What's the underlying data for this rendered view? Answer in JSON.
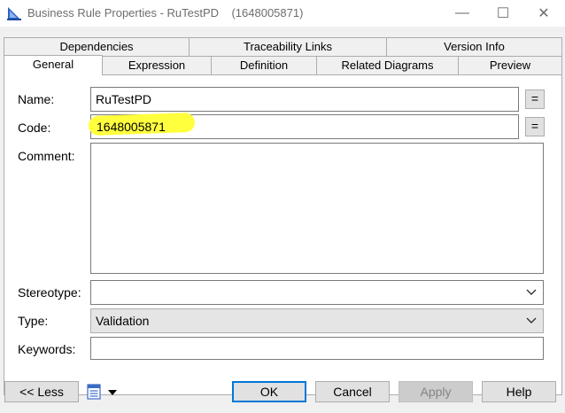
{
  "window": {
    "title": "Business Rule Properties - RuTestPD    (1648005871)",
    "minimize_glyph": "—",
    "maximize_glyph": "☐",
    "close_glyph": "✕"
  },
  "tabs": {
    "row1": [
      "Dependencies",
      "Traceability Links",
      "Version Info"
    ],
    "row2": [
      "General",
      "Expression",
      "Definition",
      "Related Diagrams",
      "Preview"
    ],
    "active": "General"
  },
  "form": {
    "name_label": "Name:",
    "name_value": "RuTestPD",
    "code_label": "Code:",
    "code_value": "1648005871",
    "comment_label": "Comment:",
    "comment_value": "",
    "stereotype_label": "Stereotype:",
    "stereotype_value": "",
    "type_label": "Type:",
    "type_value": "Validation",
    "keywords_label": "Keywords:",
    "keywords_value": "",
    "equals_glyph": "="
  },
  "footer": {
    "less_label": "<< Less",
    "ok_label": "OK",
    "cancel_label": "Cancel",
    "apply_label": "Apply",
    "help_label": "Help"
  },
  "colors": {
    "highlight": "#ffff3d",
    "default_button_border": "#0078d7"
  }
}
